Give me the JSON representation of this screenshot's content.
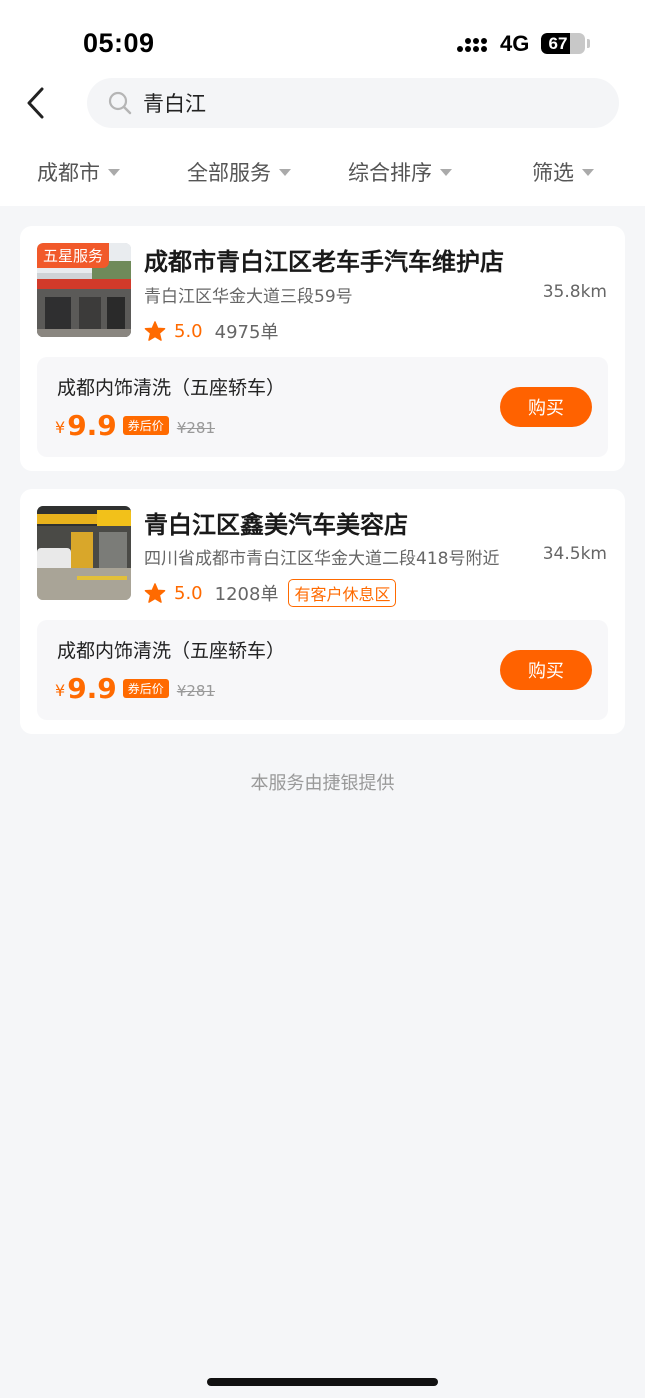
{
  "status_bar": {
    "time": "05:09",
    "network": "4G",
    "battery": "67",
    "battery_level": 0.67
  },
  "search": {
    "query": "青白江"
  },
  "filters": [
    {
      "label": "成都市"
    },
    {
      "label": "全部服务"
    },
    {
      "label": "综合排序"
    },
    {
      "label": "筛选"
    }
  ],
  "shops": [
    {
      "badge": "五星服务",
      "name": "成都市青白江区老车手汽车维护店",
      "address": "青白江区华金大道三段59号",
      "distance": "35.8km",
      "rating": "5.0",
      "orders": "4975单",
      "tag": "",
      "deal": {
        "title": "成都内饰清洗（五座轿车）",
        "currency": "¥",
        "price": "9.9",
        "coupon_label": "券后价",
        "original_price": "¥281",
        "buy_label": "购买"
      }
    },
    {
      "badge": "",
      "name": "青白江区鑫美汽车美容店",
      "address": "四川省成都市青白江区华金大道二段418号附近",
      "distance": "34.5km",
      "rating": "5.0",
      "orders": "1208单",
      "tag": "有客户休息区",
      "deal": {
        "title": "成都内饰清洗（五座轿车）",
        "currency": "¥",
        "price": "9.9",
        "coupon_label": "券后价",
        "original_price": "¥281",
        "buy_label": "购买"
      }
    }
  ],
  "footer_note": "本服务由捷银提供",
  "colors": {
    "accent": "#ff6a00",
    "badge": "#f1592a",
    "background": "#f5f6f8"
  }
}
